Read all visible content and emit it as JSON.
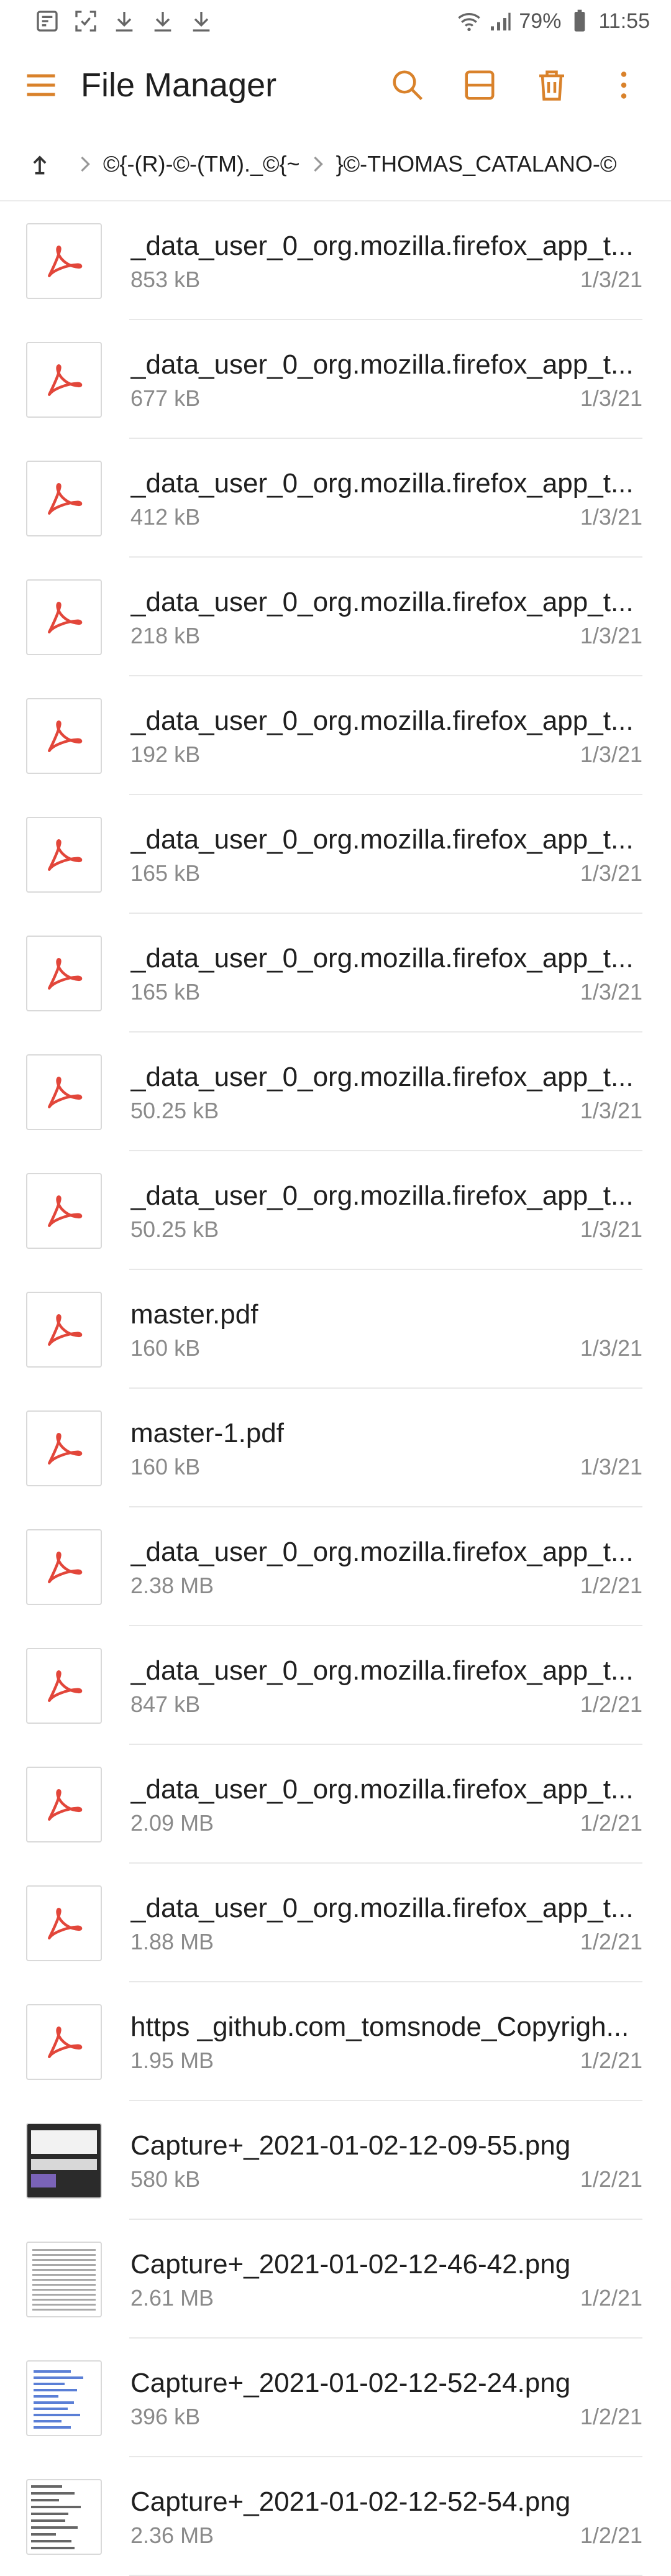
{
  "status_bar": {
    "battery": "79%",
    "time": "11:55"
  },
  "app_bar": {
    "title": "File Manager"
  },
  "breadcrumb": {
    "items": [
      "©{-(R)-©-(TM)._©{~",
      "}©-THOMAS_CATALANO-©"
    ]
  },
  "files": [
    {
      "name": "_data_user_0_org.mozilla.firefox_app_t...",
      "size": "853 kB",
      "date": "1/3/21",
      "type": "pdf"
    },
    {
      "name": "_data_user_0_org.mozilla.firefox_app_t...",
      "size": "677 kB",
      "date": "1/3/21",
      "type": "pdf"
    },
    {
      "name": "_data_user_0_org.mozilla.firefox_app_t...",
      "size": "412 kB",
      "date": "1/3/21",
      "type": "pdf"
    },
    {
      "name": "_data_user_0_org.mozilla.firefox_app_t...",
      "size": "218 kB",
      "date": "1/3/21",
      "type": "pdf"
    },
    {
      "name": "_data_user_0_org.mozilla.firefox_app_t...",
      "size": "192 kB",
      "date": "1/3/21",
      "type": "pdf"
    },
    {
      "name": "_data_user_0_org.mozilla.firefox_app_t...",
      "size": "165 kB",
      "date": "1/3/21",
      "type": "pdf"
    },
    {
      "name": "_data_user_0_org.mozilla.firefox_app_t...",
      "size": "165 kB",
      "date": "1/3/21",
      "type": "pdf"
    },
    {
      "name": "_data_user_0_org.mozilla.firefox_app_t...",
      "size": "50.25 kB",
      "date": "1/3/21",
      "type": "pdf"
    },
    {
      "name": "_data_user_0_org.mozilla.firefox_app_t...",
      "size": "50.25 kB",
      "date": "1/3/21",
      "type": "pdf"
    },
    {
      "name": "master.pdf",
      "size": "160 kB",
      "date": "1/3/21",
      "type": "pdf"
    },
    {
      "name": "master-1.pdf",
      "size": "160 kB",
      "date": "1/3/21",
      "type": "pdf"
    },
    {
      "name": "_data_user_0_org.mozilla.firefox_app_t...",
      "size": "2.38 MB",
      "date": "1/2/21",
      "type": "pdf"
    },
    {
      "name": "_data_user_0_org.mozilla.firefox_app_t...",
      "size": "847 kB",
      "date": "1/2/21",
      "type": "pdf"
    },
    {
      "name": "_data_user_0_org.mozilla.firefox_app_t...",
      "size": "2.09 MB",
      "date": "1/2/21",
      "type": "pdf"
    },
    {
      "name": "_data_user_0_org.mozilla.firefox_app_t...",
      "size": "1.88 MB",
      "date": "1/2/21",
      "type": "pdf"
    },
    {
      "name": "https _github.com_tomsnode_Copyrigh...",
      "size": "1.95 MB",
      "date": "1/2/21",
      "type": "pdf"
    },
    {
      "name": "Capture+_2021-01-02-12-09-55.png",
      "size": "580 kB",
      "date": "1/2/21",
      "type": "img-dark"
    },
    {
      "name": "Capture+_2021-01-02-12-46-42.png",
      "size": "2.61 MB",
      "date": "1/2/21",
      "type": "img-text"
    },
    {
      "name": "Capture+_2021-01-02-12-52-24.png",
      "size": "396 kB",
      "date": "1/2/21",
      "type": "img-blue"
    },
    {
      "name": "Capture+_2021-01-02-12-52-54.png",
      "size": "2.36 MB",
      "date": "1/2/21",
      "type": "img-list"
    }
  ],
  "colors": {
    "accent": "#d9822b",
    "pdf_red": "#e2463a"
  }
}
